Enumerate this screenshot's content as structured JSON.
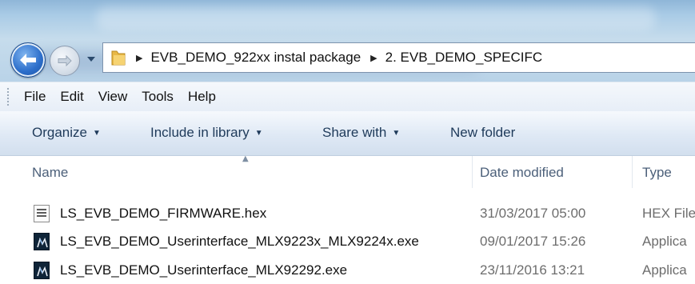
{
  "address_bar": {
    "crumbs": [
      "EVB_DEMO_922xx instal package",
      "2. EVB_DEMO_SPECIFC"
    ]
  },
  "menu": [
    "File",
    "Edit",
    "View",
    "Tools",
    "Help"
  ],
  "toolbar": {
    "organize": "Organize",
    "include_in_library": "Include in library",
    "share_with": "Share with",
    "new_folder": "New folder"
  },
  "columns": {
    "name": "Name",
    "date_modified": "Date modified",
    "type": "Type"
  },
  "files": [
    {
      "name": "LS_EVB_DEMO_FIRMWARE.hex",
      "date": "31/03/2017 05:00",
      "type": "HEX File",
      "icon": "hex-file-icon"
    },
    {
      "name": "LS_EVB_DEMO_Userinterface_MLX9223x_MLX9224x.exe",
      "date": "09/01/2017 15:26",
      "type": "Applica",
      "icon": "melexis-app-icon"
    },
    {
      "name": "LS_EVB_DEMO_Userinterface_MLX92292.exe",
      "date": "23/11/2016 13:21",
      "type": "Applica",
      "icon": "melexis-app-icon"
    }
  ],
  "colors": {
    "accent": "#2d6fcb",
    "command_text": "#1e3a5a",
    "header_text": "#4c607a",
    "secondary_text": "#6d6d6d"
  }
}
